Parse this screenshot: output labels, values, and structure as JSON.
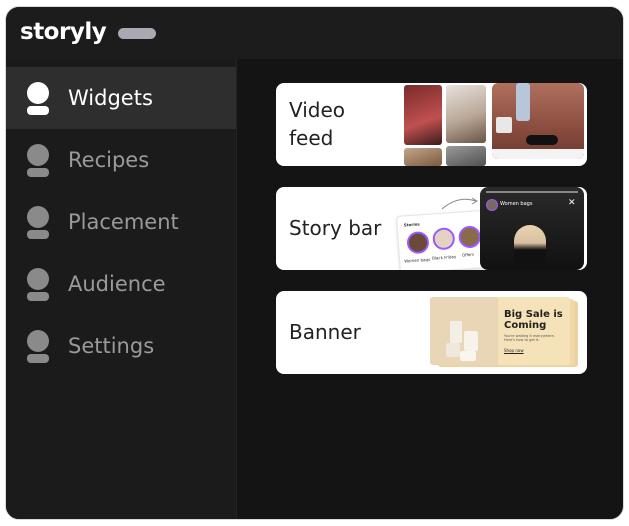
{
  "app": {
    "logo_text": "storyly"
  },
  "sidebar": {
    "items": [
      {
        "label": "Widgets",
        "active": true,
        "icon": "user-icon"
      },
      {
        "label": "Recipes",
        "active": false,
        "icon": "user-icon"
      },
      {
        "label": "Placement",
        "active": false,
        "icon": "user-icon"
      },
      {
        "label": "Audience",
        "active": false,
        "icon": "user-icon"
      },
      {
        "label": "Settings",
        "active": false,
        "icon": "user-icon"
      }
    ]
  },
  "cards": [
    {
      "label_line1": "Video",
      "label_line2": "feed"
    },
    {
      "label": "Story bar",
      "preview": {
        "header": "Stories",
        "story_labels": [
          "Women bags",
          "Black Friday",
          "Offers"
        ],
        "player_title": "Women bags"
      }
    },
    {
      "label": "Banner",
      "preview": {
        "headline": "Big Sale is Coming",
        "subtext": "You're waiting it everywhere. Here's how to get it.",
        "cta": "Shop now"
      }
    }
  ],
  "colors": {
    "window_bg": "#141414",
    "sidebar_bg": "#1b1b1b",
    "active_item_bg": "#2e2e2e",
    "accent": "#9b59ff",
    "banner_bg": "#f3dcb0"
  }
}
